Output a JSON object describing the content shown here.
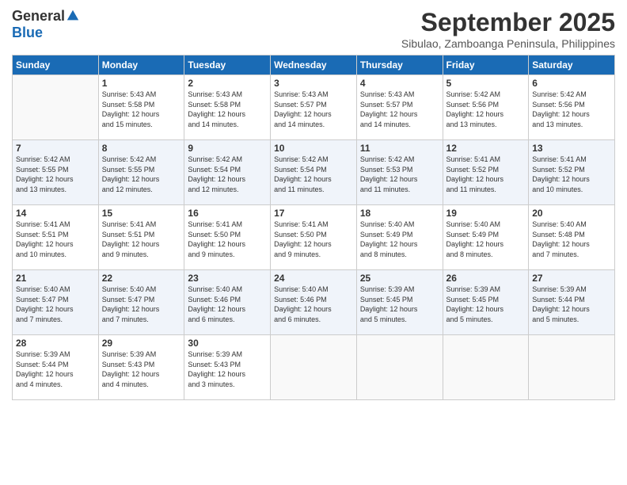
{
  "logo": {
    "general": "General",
    "blue": "Blue"
  },
  "title": "September 2025",
  "subtitle": "Sibulao, Zamboanga Peninsula, Philippines",
  "days_of_week": [
    "Sunday",
    "Monday",
    "Tuesday",
    "Wednesday",
    "Thursday",
    "Friday",
    "Saturday"
  ],
  "weeks": [
    [
      {
        "day": "",
        "info": ""
      },
      {
        "day": "1",
        "info": "Sunrise: 5:43 AM\nSunset: 5:58 PM\nDaylight: 12 hours\nand 15 minutes."
      },
      {
        "day": "2",
        "info": "Sunrise: 5:43 AM\nSunset: 5:58 PM\nDaylight: 12 hours\nand 14 minutes."
      },
      {
        "day": "3",
        "info": "Sunrise: 5:43 AM\nSunset: 5:57 PM\nDaylight: 12 hours\nand 14 minutes."
      },
      {
        "day": "4",
        "info": "Sunrise: 5:43 AM\nSunset: 5:57 PM\nDaylight: 12 hours\nand 14 minutes."
      },
      {
        "day": "5",
        "info": "Sunrise: 5:42 AM\nSunset: 5:56 PM\nDaylight: 12 hours\nand 13 minutes."
      },
      {
        "day": "6",
        "info": "Sunrise: 5:42 AM\nSunset: 5:56 PM\nDaylight: 12 hours\nand 13 minutes."
      }
    ],
    [
      {
        "day": "7",
        "info": "Sunrise: 5:42 AM\nSunset: 5:55 PM\nDaylight: 12 hours\nand 13 minutes."
      },
      {
        "day": "8",
        "info": "Sunrise: 5:42 AM\nSunset: 5:55 PM\nDaylight: 12 hours\nand 12 minutes."
      },
      {
        "day": "9",
        "info": "Sunrise: 5:42 AM\nSunset: 5:54 PM\nDaylight: 12 hours\nand 12 minutes."
      },
      {
        "day": "10",
        "info": "Sunrise: 5:42 AM\nSunset: 5:54 PM\nDaylight: 12 hours\nand 11 minutes."
      },
      {
        "day": "11",
        "info": "Sunrise: 5:42 AM\nSunset: 5:53 PM\nDaylight: 12 hours\nand 11 minutes."
      },
      {
        "day": "12",
        "info": "Sunrise: 5:41 AM\nSunset: 5:52 PM\nDaylight: 12 hours\nand 11 minutes."
      },
      {
        "day": "13",
        "info": "Sunrise: 5:41 AM\nSunset: 5:52 PM\nDaylight: 12 hours\nand 10 minutes."
      }
    ],
    [
      {
        "day": "14",
        "info": "Sunrise: 5:41 AM\nSunset: 5:51 PM\nDaylight: 12 hours\nand 10 minutes."
      },
      {
        "day": "15",
        "info": "Sunrise: 5:41 AM\nSunset: 5:51 PM\nDaylight: 12 hours\nand 9 minutes."
      },
      {
        "day": "16",
        "info": "Sunrise: 5:41 AM\nSunset: 5:50 PM\nDaylight: 12 hours\nand 9 minutes."
      },
      {
        "day": "17",
        "info": "Sunrise: 5:41 AM\nSunset: 5:50 PM\nDaylight: 12 hours\nand 9 minutes."
      },
      {
        "day": "18",
        "info": "Sunrise: 5:40 AM\nSunset: 5:49 PM\nDaylight: 12 hours\nand 8 minutes."
      },
      {
        "day": "19",
        "info": "Sunrise: 5:40 AM\nSunset: 5:49 PM\nDaylight: 12 hours\nand 8 minutes."
      },
      {
        "day": "20",
        "info": "Sunrise: 5:40 AM\nSunset: 5:48 PM\nDaylight: 12 hours\nand 7 minutes."
      }
    ],
    [
      {
        "day": "21",
        "info": "Sunrise: 5:40 AM\nSunset: 5:47 PM\nDaylight: 12 hours\nand 7 minutes."
      },
      {
        "day": "22",
        "info": "Sunrise: 5:40 AM\nSunset: 5:47 PM\nDaylight: 12 hours\nand 7 minutes."
      },
      {
        "day": "23",
        "info": "Sunrise: 5:40 AM\nSunset: 5:46 PM\nDaylight: 12 hours\nand 6 minutes."
      },
      {
        "day": "24",
        "info": "Sunrise: 5:40 AM\nSunset: 5:46 PM\nDaylight: 12 hours\nand 6 minutes."
      },
      {
        "day": "25",
        "info": "Sunrise: 5:39 AM\nSunset: 5:45 PM\nDaylight: 12 hours\nand 5 minutes."
      },
      {
        "day": "26",
        "info": "Sunrise: 5:39 AM\nSunset: 5:45 PM\nDaylight: 12 hours\nand 5 minutes."
      },
      {
        "day": "27",
        "info": "Sunrise: 5:39 AM\nSunset: 5:44 PM\nDaylight: 12 hours\nand 5 minutes."
      }
    ],
    [
      {
        "day": "28",
        "info": "Sunrise: 5:39 AM\nSunset: 5:44 PM\nDaylight: 12 hours\nand 4 minutes."
      },
      {
        "day": "29",
        "info": "Sunrise: 5:39 AM\nSunset: 5:43 PM\nDaylight: 12 hours\nand 4 minutes."
      },
      {
        "day": "30",
        "info": "Sunrise: 5:39 AM\nSunset: 5:43 PM\nDaylight: 12 hours\nand 3 minutes."
      },
      {
        "day": "",
        "info": ""
      },
      {
        "day": "",
        "info": ""
      },
      {
        "day": "",
        "info": ""
      },
      {
        "day": "",
        "info": ""
      }
    ]
  ]
}
